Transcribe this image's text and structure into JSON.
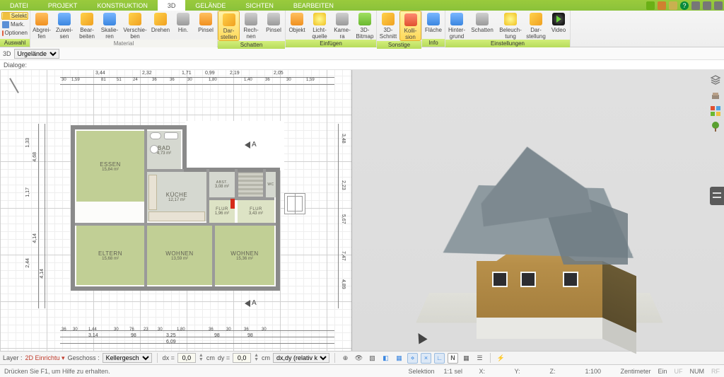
{
  "menu": {
    "items": [
      "DATEI",
      "PROJEKT",
      "KONSTRUKTION",
      "3D",
      "GELÄNDE",
      "SICHTEN",
      "BEARBEITEN"
    ],
    "active": 3
  },
  "ribbon": {
    "sel": {
      "selekt": "Selekt",
      "mark": "Mark.",
      "optionen": "Optionen",
      "group": "Auswahl"
    },
    "material": {
      "abgreifen": "Abgrei-\nfen",
      "zuweisen": "Zuwei-\nsen",
      "bearbeiten": "Bear-\nbeiten",
      "skalieren": "Skalie-\nren",
      "verschieben": "Verschie-\nben",
      "drehen": "Drehen",
      "hin": "Hin.",
      "pinsel": "Pinsel",
      "group": "Material"
    },
    "schatten": {
      "darstellen": "Dar-\nstellen",
      "rechnen": "Rech-\nnen",
      "pinsel": "Pinsel",
      "group": "Schatten"
    },
    "einfuegen": {
      "objekt": "Objekt",
      "licht": "Licht-\nquelle",
      "kamera": "Kame-\nra",
      "bitmap": "3D-\nBitmap",
      "group": "Einfügen"
    },
    "sonstige": {
      "schnitt": "3D-\nSchnitt",
      "kollision": "Kolli-\nsion",
      "group": "Sonstige"
    },
    "info": {
      "flache": "Fläche",
      "group": "Info"
    },
    "einstellungen": {
      "hinter": "Hinter-\ngrund",
      "schatten": "Schatten",
      "beleucht": "Beleuch-\ntung",
      "darstellung": "Dar-\nstellung",
      "video": "Video",
      "group": "Einstellungen"
    }
  },
  "subbar": {
    "label3d": "3D",
    "layer": "Urgelände"
  },
  "dialoge": "Dialoge:",
  "dims": {
    "top_major": [
      "3,44",
      "2,32",
      "1,71",
      "0,99",
      "2,19",
      "2,05"
    ],
    "top_minor": [
      "30",
      "1,59",
      "81",
      "51",
      "24",
      "36",
      "36",
      "30",
      "1,80",
      "1,40",
      "36",
      "30",
      "1,59"
    ],
    "bot3": [
      "6,09"
    ],
    "bot2": [
      "3,14",
      "98",
      "3,25",
      "98",
      "98"
    ],
    "bot1": [
      "36",
      "30",
      "1,44",
      "30",
      "76",
      "23",
      "30",
      "1,80",
      "36",
      "30",
      "36",
      "30"
    ],
    "left": [
      "4,68",
      "4,14",
      "4,14"
    ],
    "left2": [
      "1,33",
      "1,17",
      "2,44"
    ],
    "right": [
      "3,48",
      "2,23",
      "5,67",
      "7,47",
      "4,89"
    ]
  },
  "rooms": {
    "essen": {
      "name": "ESSEN",
      "area": "15,84 m²"
    },
    "bad": {
      "name": "BAD",
      "area": "4,73 m²"
    },
    "kueche": {
      "name": "KÜCHE",
      "area": "12,17 m²"
    },
    "eltern": {
      "name": "ELTERN",
      "area": "15,68 m²"
    },
    "wohnen1": {
      "name": "WOHNEN",
      "area": "13,59 m²"
    },
    "wohnen2": {
      "name": "WOHNEN",
      "area": "15,36 m²"
    },
    "flur1": {
      "name": "FLUR",
      "area": "1,96 m²"
    },
    "flur2": {
      "name": "FLUR",
      "area": "3,43 m²"
    },
    "abst": {
      "name": "ABST.",
      "area": "3,08 m²"
    },
    "wc": {
      "name": "WC",
      "area": ""
    }
  },
  "section": "A",
  "layerbar": {
    "layer_lbl": "Layer :",
    "layer_link": "2D Einrichtu",
    "geschoss_lbl": "Geschoss :",
    "geschoss_val": "Kellergesch",
    "dx": "dx =",
    "dy": "dy =",
    "cm": "cm",
    "zero": "0,0",
    "mode": "dx,dy (relativ ka",
    "nbtn": "N"
  },
  "status": {
    "help": "Drücken Sie F1, um Hilfe zu erhalten.",
    "sel": "Selektion",
    "scale1": "1:1 sel",
    "x": "X:",
    "y": "Y:",
    "z": "Z:",
    "scale2": "1:100",
    "unit": "Zentimeter",
    "ein": "Ein",
    "uf": "UF",
    "num": "NUM",
    "rf": "RF"
  }
}
